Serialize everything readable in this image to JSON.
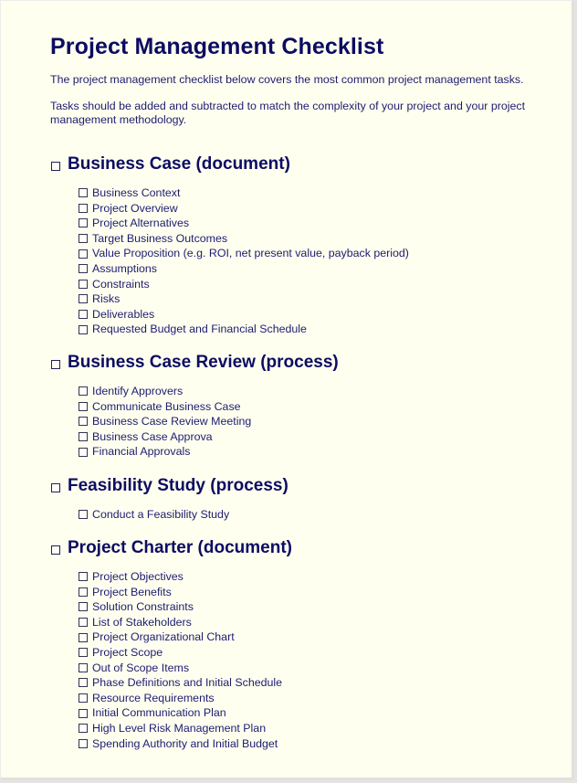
{
  "document": {
    "title": "Project Management Checklist",
    "intro": [
      "The project management checklist below covers the most common project management tasks.",
      "Tasks should be added and subtracted to match the complexity of your project and your project management methodology."
    ],
    "sections": [
      {
        "heading": "Business Case (document)",
        "checked": false,
        "items": [
          {
            "label": "Business Context",
            "checked": false
          },
          {
            "label": "Project Overview",
            "checked": false
          },
          {
            "label": "Project Alternatives",
            "checked": false
          },
          {
            "label": "Target Business Outcomes",
            "checked": false
          },
          {
            "label": "Value Proposition (e.g. ROI, net present value, payback period)",
            "checked": false
          },
          {
            "label": "Assumptions",
            "checked": false
          },
          {
            "label": "Constraints",
            "checked": false
          },
          {
            "label": "Risks",
            "checked": false
          },
          {
            "label": "Deliverables",
            "checked": false
          },
          {
            "label": "Requested Budget and Financial Schedule",
            "checked": false
          }
        ]
      },
      {
        "heading": "Business Case Review (process)",
        "checked": false,
        "items": [
          {
            "label": "Identify Approvers",
            "checked": false
          },
          {
            "label": "Communicate Business Case",
            "checked": false
          },
          {
            "label": "Business Case Review Meeting",
            "checked": false
          },
          {
            "label": "Business Case Approva",
            "checked": false
          },
          {
            "label": "Financial Approvals",
            "checked": false
          }
        ]
      },
      {
        "heading": "Feasibility Study (process)",
        "checked": false,
        "items": [
          {
            "label": "Conduct a Feasibility Study",
            "checked": false
          }
        ]
      },
      {
        "heading": "Project Charter (document)",
        "checked": false,
        "items": [
          {
            "label": "Project Objectives",
            "checked": false
          },
          {
            "label": "Project Benefits",
            "checked": false
          },
          {
            "label": "Solution Constraints",
            "checked": false
          },
          {
            "label": "List of Stakeholders",
            "checked": false
          },
          {
            "label": "Project Organizational Chart",
            "checked": false
          },
          {
            "label": "Project Scope",
            "checked": false
          },
          {
            "label": "Out of Scope Items",
            "checked": false
          },
          {
            "label": "Phase Definitions and Initial Schedule",
            "checked": false
          },
          {
            "label": "Resource Requirements",
            "checked": false
          },
          {
            "label": "Initial Communication Plan",
            "checked": false
          },
          {
            "label": "High Level Risk Management Plan",
            "checked": false
          },
          {
            "label": "Spending Authority and Initial Budget",
            "checked": false
          }
        ]
      }
    ]
  },
  "colors": {
    "page_background": "#fffff0",
    "text": "#16166b",
    "heading": "#0c0c62"
  }
}
